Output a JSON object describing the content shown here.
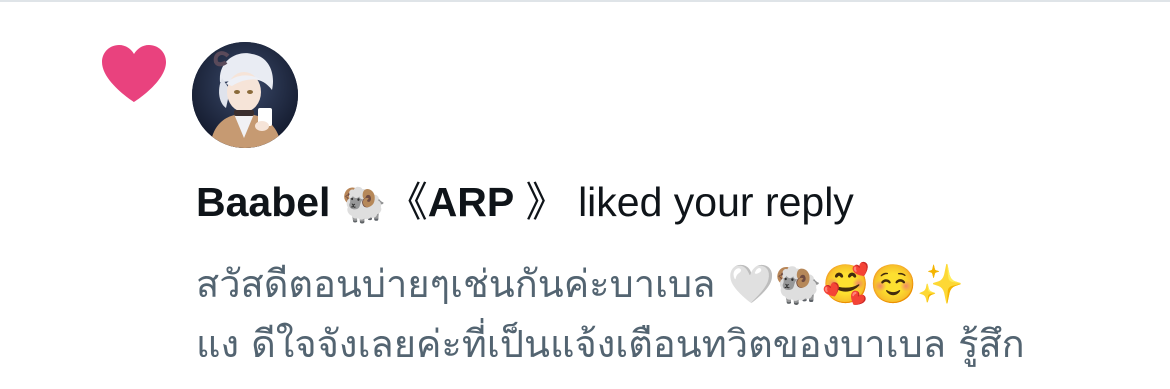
{
  "notification": {
    "type_icon": "heart-icon",
    "type_color": "#e9427e",
    "avatar": "user-avatar",
    "user_display_name": "Baabel",
    "name_emoji": "🐏",
    "bracket_open": "《",
    "tag": "ARP",
    "bracket_close": "》",
    "action_text": "liked your reply",
    "reply_lines": [
      "สวัสดีตอนบ่ายๆเช่นกันค่ะบาเบล 🤍🐏🥰☺️✨",
      "แง ดีใจจังเลยค่ะที่เป็นแจ้งเตือนทวิตของบาเบล รู้สึก"
    ],
    "text_color": "#0f1419",
    "muted_color": "#536471"
  }
}
